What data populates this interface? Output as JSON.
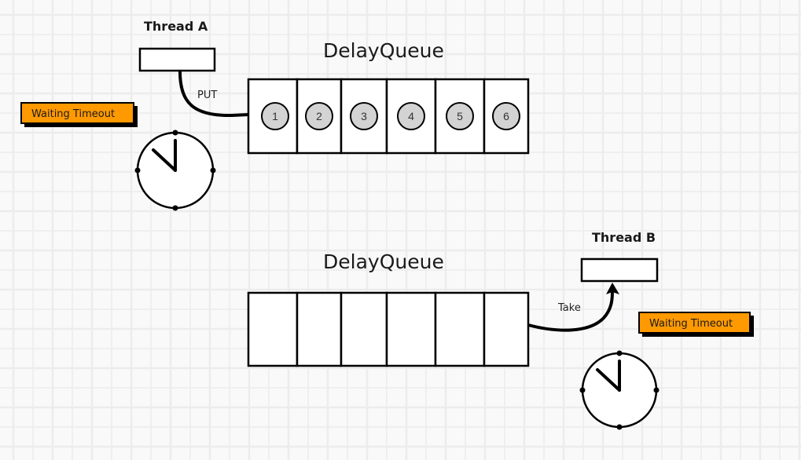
{
  "colors": {
    "background": "#f9f9f9",
    "grid_line": "#ececec",
    "badge_fill": "#ff9900",
    "stroke": "#000000",
    "element_fill": "#d3d3d3",
    "box_fill": "#ffffff"
  },
  "top_section": {
    "thread_label": "Thread A",
    "queue_title": "DelayQueue",
    "arrow_label": "PUT",
    "badge_label": "Waiting Timeout",
    "queue_items": [
      "1",
      "2",
      "3",
      "4",
      "5",
      "6"
    ],
    "clock_icon": "clock-icon"
  },
  "bottom_section": {
    "thread_label": "Thread B",
    "queue_title": "DelayQueue",
    "arrow_label": "Take",
    "badge_label": "Waiting Timeout",
    "queue_items": [
      "",
      "",
      "",
      "",
      "",
      ""
    ],
    "clock_icon": "clock-icon"
  }
}
